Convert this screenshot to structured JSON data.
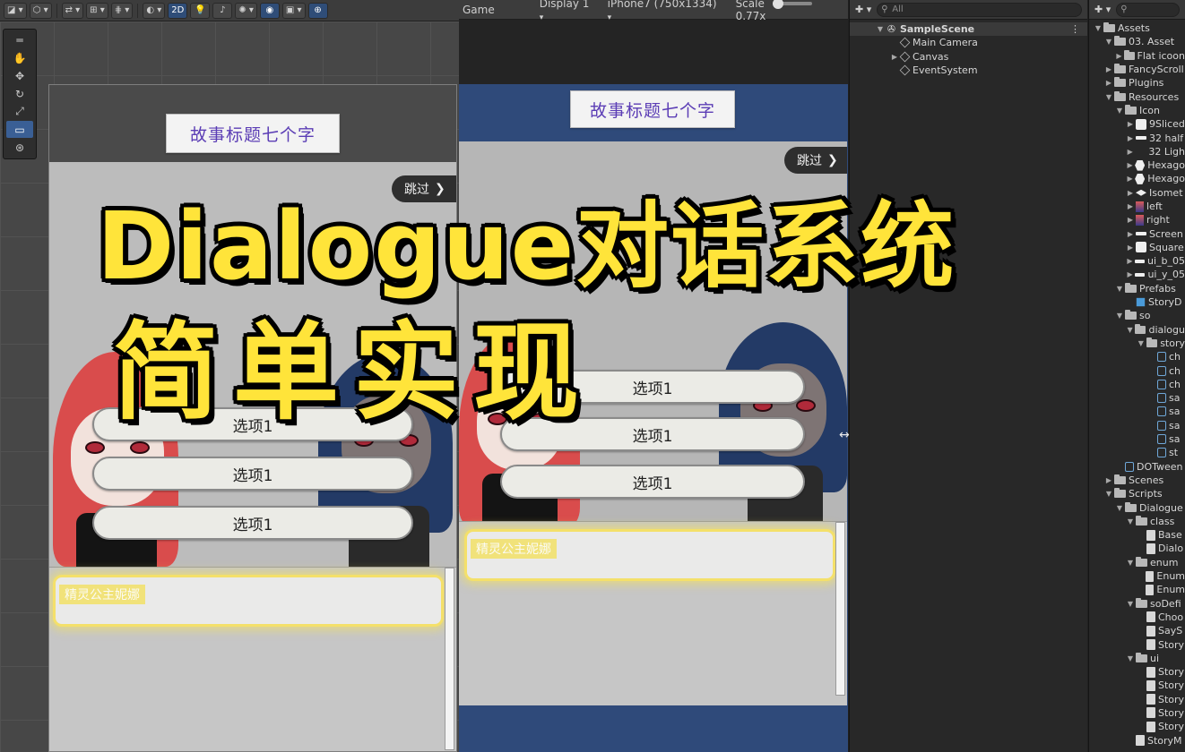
{
  "scene_toolbar": {
    "mode_2d_label": "2D",
    "tools": [
      "hand-tool",
      "move-tool",
      "rotate-tool",
      "scale-tool",
      "rect-tool",
      "transform-tool"
    ]
  },
  "game_toolbar": {
    "tab_label": "Game",
    "display_label": "Display 1",
    "resolution_label": "iPhone7 (750x1334)",
    "scale_label": "Scale",
    "scale_value": "0.77x"
  },
  "story": {
    "title": "故事标题七个字",
    "skip_label": "跳过",
    "choices": [
      "选项1",
      "选项1",
      "选项1"
    ],
    "speaker_name": "精灵公主妮娜"
  },
  "overlay": {
    "line1": "Dialogue对话系统",
    "line2": "简单实现"
  },
  "hierarchy": {
    "search_placeholder": "All",
    "scene_name": "SampleScene",
    "children": [
      "Main Camera",
      "Canvas",
      "EventSystem"
    ]
  },
  "project": {
    "search_placeholder": "",
    "items": [
      {
        "label": "Assets",
        "depth": 0,
        "icon": "folder",
        "arrow": "open"
      },
      {
        "label": "03. Asset",
        "depth": 1,
        "icon": "folder",
        "arrow": "open"
      },
      {
        "label": "Flat icoon",
        "depth": 2,
        "icon": "folder",
        "arrow": "closed"
      },
      {
        "label": "FancyScroll",
        "depth": 1,
        "icon": "folder",
        "arrow": "closed"
      },
      {
        "label": "Plugins",
        "depth": 1,
        "icon": "folder",
        "arrow": "closed"
      },
      {
        "label": "Resources",
        "depth": 1,
        "icon": "folder",
        "arrow": "open"
      },
      {
        "label": "Icon",
        "depth": 2,
        "icon": "folder",
        "arrow": "open"
      },
      {
        "label": "9Sliced",
        "depth": 3,
        "icon": "img",
        "arrow": "closed"
      },
      {
        "label": "32 half",
        "depth": 3,
        "icon": "bar",
        "arrow": "closed"
      },
      {
        "label": "32 Ligh",
        "depth": 3,
        "icon": "none",
        "arrow": "closed"
      },
      {
        "label": "Hexago",
        "depth": 3,
        "icon": "hex",
        "arrow": "closed"
      },
      {
        "label": "Hexago",
        "depth": 3,
        "icon": "hex",
        "arrow": "closed"
      },
      {
        "label": "Isomet",
        "depth": 3,
        "icon": "diamond",
        "arrow": "closed"
      },
      {
        "label": "left",
        "depth": 3,
        "icon": "pic",
        "arrow": "closed"
      },
      {
        "label": "right",
        "depth": 3,
        "icon": "pic",
        "arrow": "closed"
      },
      {
        "label": "Screen",
        "depth": 3,
        "icon": "bar",
        "arrow": "closed"
      },
      {
        "label": "Square",
        "depth": 3,
        "icon": "img",
        "arrow": "closed"
      },
      {
        "label": "ui_b_05",
        "depth": 3,
        "icon": "bar",
        "arrow": "closed"
      },
      {
        "label": "ui_y_05",
        "depth": 3,
        "icon": "bar",
        "arrow": "closed"
      },
      {
        "label": "Prefabs",
        "depth": 2,
        "icon": "folder",
        "arrow": "open"
      },
      {
        "label": "StoryD",
        "depth": 3,
        "icon": "prefab",
        "arrow": "none"
      },
      {
        "label": "so",
        "depth": 2,
        "icon": "folder",
        "arrow": "open"
      },
      {
        "label": "dialogu",
        "depth": 3,
        "icon": "folder",
        "arrow": "open"
      },
      {
        "label": "story",
        "depth": 4,
        "icon": "folder",
        "arrow": "open"
      },
      {
        "label": "ch",
        "depth": 5,
        "icon": "so",
        "arrow": "none"
      },
      {
        "label": "ch",
        "depth": 5,
        "icon": "so",
        "arrow": "none"
      },
      {
        "label": "ch",
        "depth": 5,
        "icon": "so",
        "arrow": "none"
      },
      {
        "label": "sa",
        "depth": 5,
        "icon": "so",
        "arrow": "none"
      },
      {
        "label": "sa",
        "depth": 5,
        "icon": "so",
        "arrow": "none"
      },
      {
        "label": "sa",
        "depth": 5,
        "icon": "so",
        "arrow": "none"
      },
      {
        "label": "sa",
        "depth": 5,
        "icon": "so",
        "arrow": "none"
      },
      {
        "label": "st",
        "depth": 5,
        "icon": "so",
        "arrow": "none"
      },
      {
        "label": "DOTween",
        "depth": 2,
        "icon": "so",
        "arrow": "none"
      },
      {
        "label": "Scenes",
        "depth": 1,
        "icon": "folder",
        "arrow": "closed"
      },
      {
        "label": "Scripts",
        "depth": 1,
        "icon": "folder",
        "arrow": "open"
      },
      {
        "label": "Dialogue",
        "depth": 2,
        "icon": "folder",
        "arrow": "open"
      },
      {
        "label": "class",
        "depth": 3,
        "icon": "folder",
        "arrow": "open"
      },
      {
        "label": "Base",
        "depth": 4,
        "icon": "script",
        "arrow": "none"
      },
      {
        "label": "Dialo",
        "depth": 4,
        "icon": "script",
        "arrow": "none"
      },
      {
        "label": "enum",
        "depth": 3,
        "icon": "folder",
        "arrow": "open"
      },
      {
        "label": "Enum",
        "depth": 4,
        "icon": "script",
        "arrow": "none"
      },
      {
        "label": "Enum",
        "depth": 4,
        "icon": "script",
        "arrow": "none"
      },
      {
        "label": "soDefi",
        "depth": 3,
        "icon": "folder",
        "arrow": "open"
      },
      {
        "label": "Choo",
        "depth": 4,
        "icon": "script",
        "arrow": "none"
      },
      {
        "label": "SayS",
        "depth": 4,
        "icon": "script",
        "arrow": "none"
      },
      {
        "label": "Story",
        "depth": 4,
        "icon": "script",
        "arrow": "none"
      },
      {
        "label": "ui",
        "depth": 3,
        "icon": "folder",
        "arrow": "open"
      },
      {
        "label": "Story",
        "depth": 4,
        "icon": "script",
        "arrow": "none"
      },
      {
        "label": "Story",
        "depth": 4,
        "icon": "script",
        "arrow": "none"
      },
      {
        "label": "Story",
        "depth": 4,
        "icon": "script",
        "arrow": "none"
      },
      {
        "label": "Story",
        "depth": 4,
        "icon": "script",
        "arrow": "none"
      },
      {
        "label": "Story",
        "depth": 4,
        "icon": "script",
        "arrow": "none"
      },
      {
        "label": "StoryM",
        "depth": 3,
        "icon": "script",
        "arrow": "none"
      }
    ]
  },
  "colors": {
    "overlay_text": "#ffe43a",
    "title_text": "#5b3db5",
    "game_background": "#2f4a7a",
    "dialog_glow": "#f4e06a"
  }
}
